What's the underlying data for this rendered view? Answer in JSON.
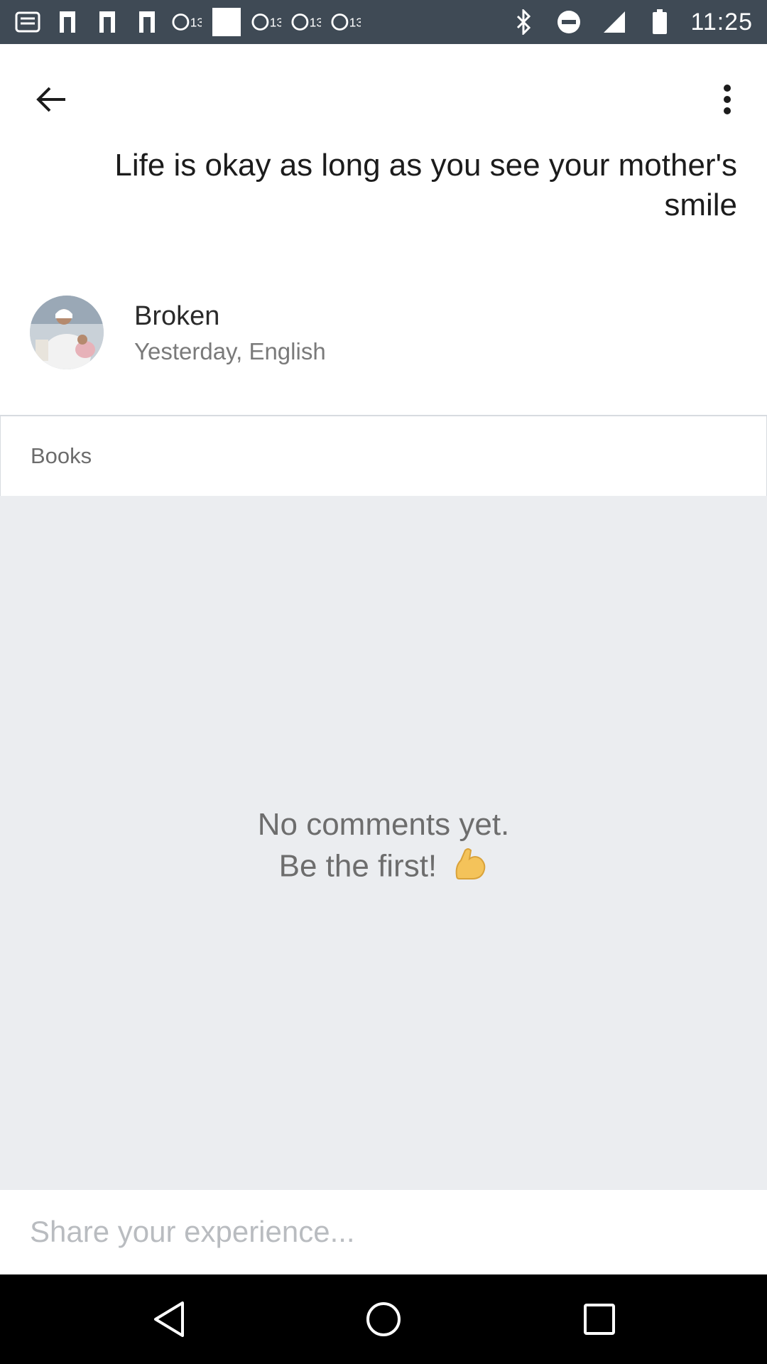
{
  "status_bar": {
    "time": "11:25",
    "left_icons": [
      "notification-icon",
      "flag-icon",
      "flag-icon",
      "flag-icon",
      "abc13-icon",
      "blank-card-icon",
      "abc13-icon",
      "abc13-icon",
      "abc13-icon"
    ],
    "badge_text": "13",
    "right_icons": [
      "bluetooth-icon",
      "do-not-disturb-icon",
      "signal-icon",
      "battery-icon"
    ]
  },
  "app_bar": {
    "back_icon": "arrow-back-icon",
    "menu_icon": "more-vert-icon"
  },
  "post": {
    "title": "Life is okay as long as you see your mother's smile",
    "author": "Broken",
    "meta": "Yesterday, English",
    "category": "Books"
  },
  "comments": {
    "empty_line1": "No comments yet.",
    "empty_line2": "Be the first!",
    "emoji": "💪"
  },
  "input": {
    "placeholder": "Share your experience..."
  },
  "nav_bar": {
    "icons": [
      "back-triangle-icon",
      "home-circle-icon",
      "recents-square-icon"
    ]
  },
  "colors": {
    "status_bar": "#3f4a55",
    "comments_bg": "#ebedf0",
    "nav_bar": "#000000"
  }
}
